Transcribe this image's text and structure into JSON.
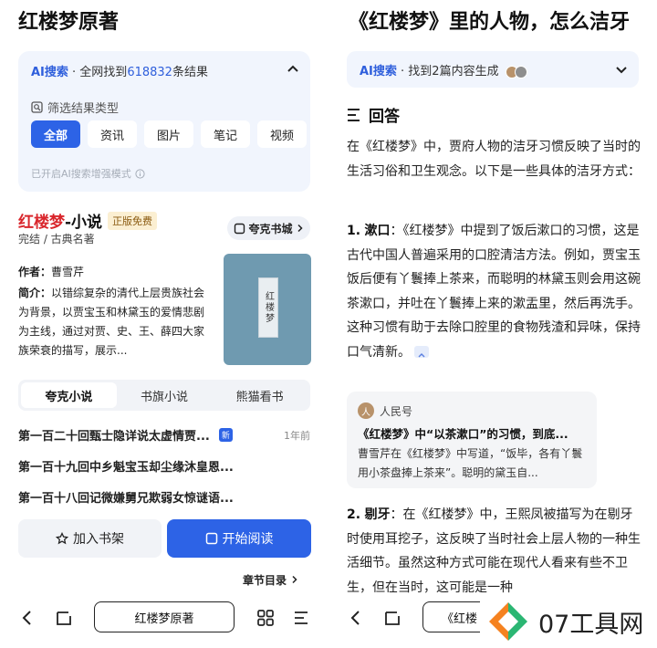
{
  "left": {
    "page_title": "红楼梦原著",
    "ai_search": {
      "label": "AI搜索",
      "summary_prefix": "· 全网找到",
      "result_count": "618832",
      "summary_suffix": "条结果",
      "filter_label": "筛选结果类型",
      "chips": [
        "全部",
        "资讯",
        "图片",
        "笔记",
        "视频"
      ],
      "note": "已开启AI搜索增强模式"
    },
    "book": {
      "title_red": "红楼梦",
      "title_rest": "-小说",
      "badge": "正版免费",
      "status": "完结 / 古典名著",
      "store_button": "夸克书城",
      "author_label": "作者：",
      "author": "曹雪芹",
      "intro_label": "简介：",
      "intro": "以错综复杂的清代上层贵族社会为背景，以贾宝玉和林黛玉的爱情悲剧为主线，通过对贾、史、王、薛四大家族荣衰的描写，展示...",
      "cover_text": "红楼梦"
    },
    "tabs": [
      "夸克小说",
      "书旗小说",
      "熊猫看书"
    ],
    "chapters": [
      {
        "title": "第一百二十回甄士隐详说太虚情贾...",
        "badge": "新",
        "time": "1年前"
      },
      {
        "title": "第一百十九回中乡魁宝玉却尘缘沐皇恩...",
        "badge": "",
        "time": ""
      },
      {
        "title": "第一百十八回记微嫌舅兄欺弱女惊谜语...",
        "badge": "",
        "time": ""
      }
    ],
    "add_shelf": "加入书架",
    "start_read": "开始阅读",
    "toc": "章节目录",
    "address": "红楼梦原著"
  },
  "right": {
    "page_title": "《红楼梦》里的人物，怎么洁牙",
    "ai_search": {
      "label": "AI搜索",
      "summary": "· 找到2篇内容生成"
    },
    "answer_heading": "回答",
    "intro": "在《红楼梦》中，贾府人物的洁牙习惯反映了当时的生活习俗和卫生观念。以下是一些具体的洁牙方式：",
    "point1_num": "1.",
    "point1_title": "漱口",
    "point1_text": "：《红楼梦》中提到了饭后漱口的习惯，这是古代中国人普遍采用的口腔清洁方法。例如，贾宝玉饭后便有丫鬟捧上茶来，而聪明的林黛玉则会用这碗茶漱口，并吐在丫鬟捧上来的漱盂里，然后再洗手。这种习惯有助于去除口腔里的食物残渣和异味，保持口气清新。",
    "reference": {
      "source": "人民号",
      "avatar_text": "人",
      "title": "《红楼梦》中“以茶漱口”的习惯，到底...",
      "body": "曹雪芹在《红楼梦》中写道，“饭毕，各有丫鬟用小茶盘捧上茶来”。聪明的黛玉自..."
    },
    "point2_num": "2.",
    "point2_title": "剔牙",
    "point2_text": "：在《红楼梦》中，王熙凤被描写为在剔牙时使用耳挖子，这反映了当时社会上层人物的一种生活细节。虽然这种方式可能在现代人看来有些不卫生，但在当时，这可能是一种",
    "address": "《红楼"
  },
  "watermark": "07工具网",
  "colors": {
    "accent": "#2d63e6",
    "title_red": "#d9262c",
    "card_bg": "#f1f5fd"
  }
}
